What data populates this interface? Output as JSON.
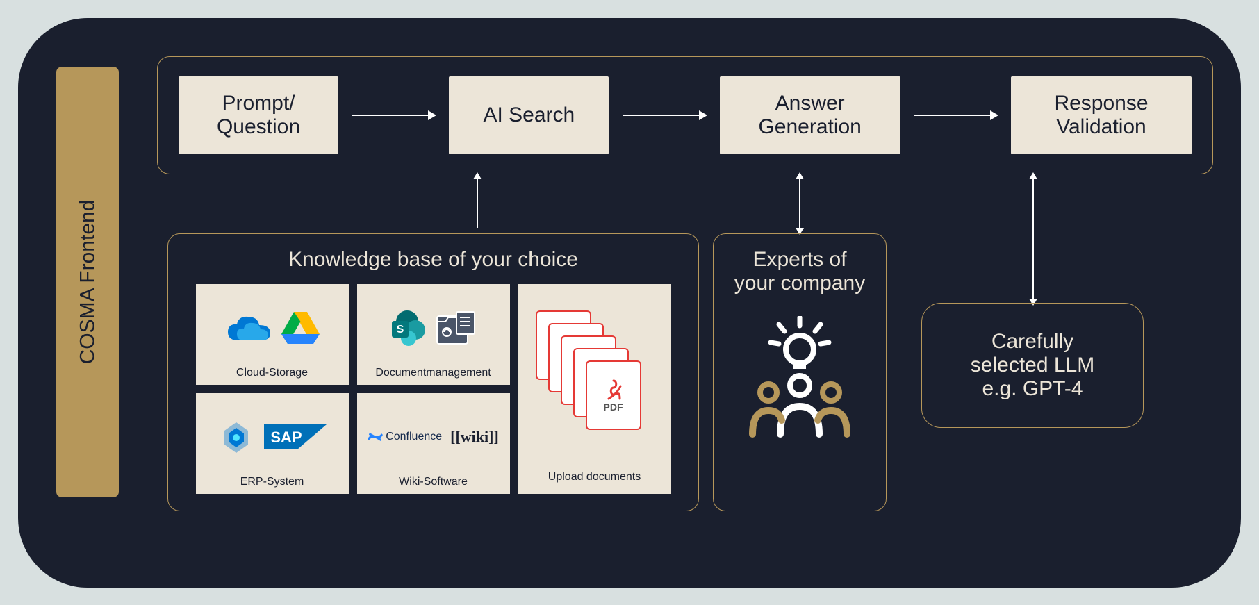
{
  "sidebar": {
    "label": "COSMA Frontend"
  },
  "pipeline": {
    "steps": [
      {
        "line1": "Prompt/",
        "line2": "Question"
      },
      {
        "line1": "AI Search",
        "line2": ""
      },
      {
        "line1": "Answer",
        "line2": "Generation"
      },
      {
        "line1": "Response",
        "line2": "Validation"
      }
    ]
  },
  "kb": {
    "title": "Knowledge base of your choice",
    "tiles": {
      "cloud": "Cloud-Storage",
      "docmgmt": "Documentmanagement",
      "erp": "ERP-System",
      "wiki": "Wiki-Software",
      "upload": "Upload documents",
      "wiki_badge": "[[wiki]]",
      "confluence": "Confluence",
      "sap": "SAP",
      "pdf": "PDF"
    }
  },
  "experts": {
    "line1": "Experts of",
    "line2": "your company"
  },
  "llm": {
    "line1": "Carefully",
    "line2": "selected LLM",
    "line3": "e.g. GPT-4"
  },
  "colors": {
    "bg": "#1a1f2e",
    "gold": "#b6975a",
    "cream": "#ece5d8"
  }
}
